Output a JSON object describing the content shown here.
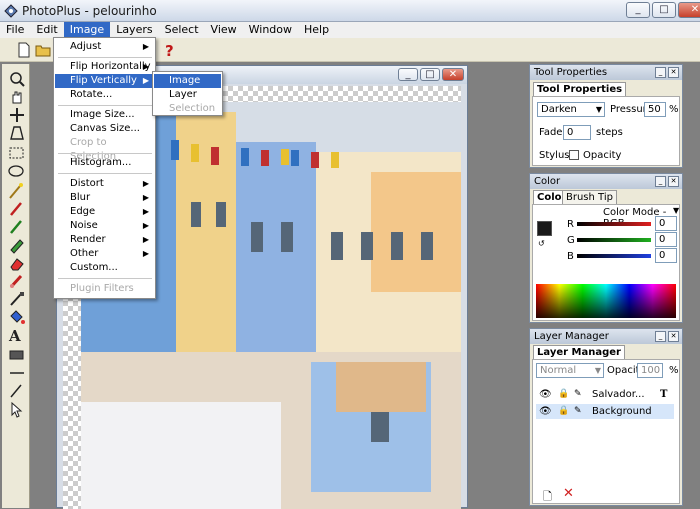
{
  "window": {
    "title": "PhotoPlus - pelourinho",
    "controls": [
      "_",
      "□",
      "✕"
    ]
  },
  "menubar": [
    "File",
    "Edit",
    "Image",
    "Layers",
    "Select",
    "View",
    "Window",
    "Help"
  ],
  "image_menu": {
    "items": [
      {
        "label": "Adjust",
        "submenu": true
      },
      {
        "label": "Flip Horizontally",
        "submenu": true
      },
      {
        "label": "Flip Vertically",
        "submenu": true,
        "highlighted": true
      },
      {
        "label": "Rotate..."
      },
      {
        "label": "Image Size..."
      },
      {
        "label": "Canvas Size..."
      },
      {
        "label": "Crop to Selection",
        "disabled": true
      },
      {
        "label": "Histogram..."
      },
      {
        "label": "Distort",
        "submenu": true
      },
      {
        "label": "Blur",
        "submenu": true
      },
      {
        "label": "Edge",
        "submenu": true
      },
      {
        "label": "Noise",
        "submenu": true
      },
      {
        "label": "Render",
        "submenu": true
      },
      {
        "label": "Other",
        "submenu": true
      },
      {
        "label": "Custom..."
      },
      {
        "label": "Plugin Filters",
        "disabled": true
      }
    ]
  },
  "flip_submenu": {
    "items": [
      {
        "label": "Image",
        "highlighted": true
      },
      {
        "label": "Layer"
      },
      {
        "label": "Selection",
        "disabled": true
      }
    ]
  },
  "tool_properties": {
    "title": "Tool Properties",
    "tab": "Tool Properties",
    "blend_mode": "Darken",
    "pressure_label": "Pressure:",
    "pressure_value": "50",
    "pressure_unit": "%",
    "fade_label": "Fade:",
    "fade_value": "0",
    "fade_unit": "steps",
    "stylus_label": "Stylus:",
    "opacity_label": "Opacity"
  },
  "color_panel": {
    "title": "Color",
    "tabs": [
      "Color",
      "Brush Tip"
    ],
    "mode": "Color Mode - RGB",
    "channels": [
      {
        "label": "R",
        "value": "0",
        "color": "#e02020"
      },
      {
        "label": "G",
        "value": "0",
        "color": "#20b020"
      },
      {
        "label": "B",
        "value": "0",
        "color": "#2040e0"
      }
    ],
    "foreground": "#1a1a1a"
  },
  "layer_manager": {
    "title": "Layer Manager",
    "tab": "Layer Manager",
    "blend": "Normal",
    "opacity_label": "Opacity:",
    "opacity_value": "100",
    "opacity_unit": "%",
    "layers": [
      {
        "name": "Salvador...",
        "type": "text"
      },
      {
        "name": "Background",
        "type": "image",
        "selected": true
      }
    ]
  },
  "colors": {
    "accent": "#3169c6",
    "menu_highlight": "#3169c6"
  }
}
